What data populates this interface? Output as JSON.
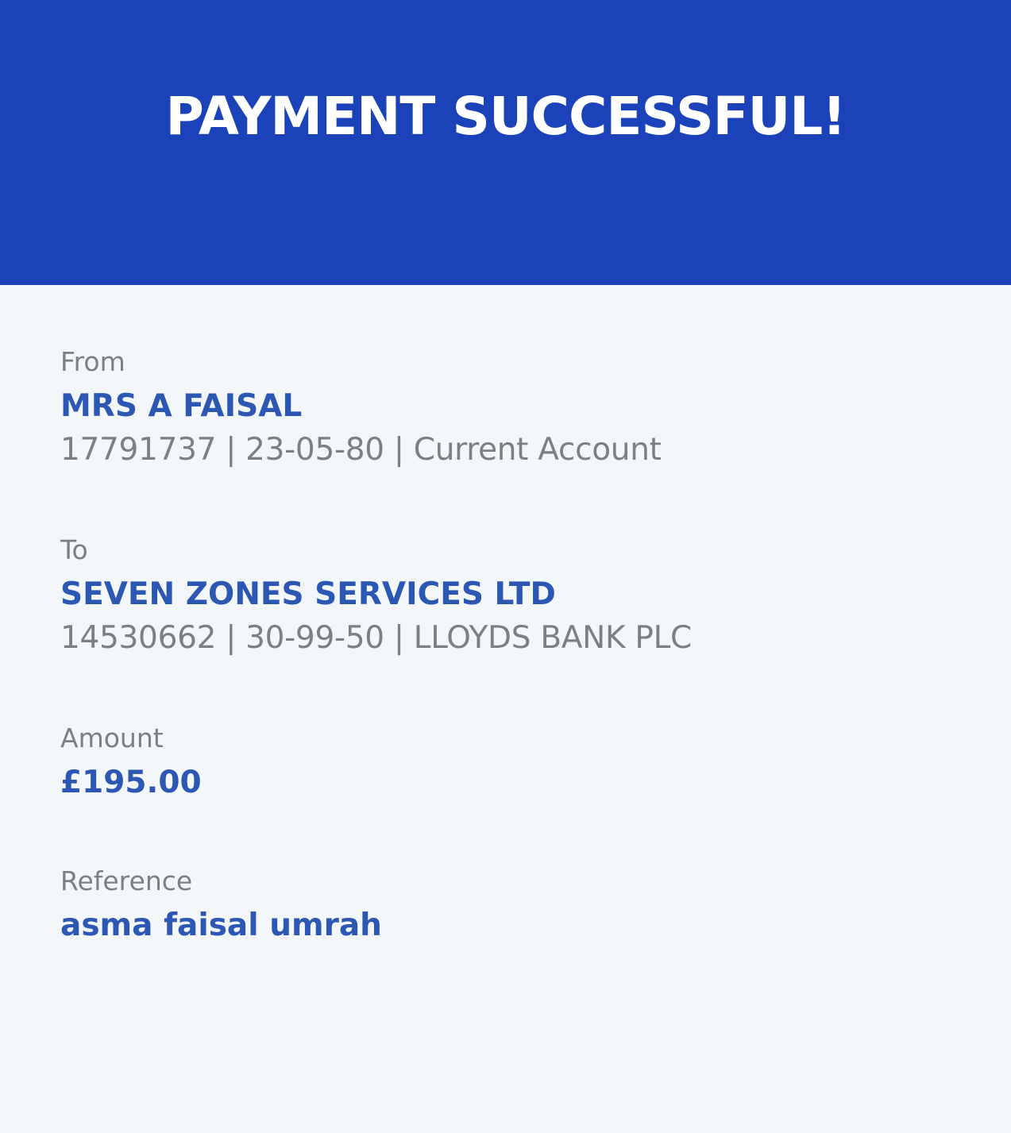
{
  "header": {
    "title": "PAYMENT SUCCESSFUL!",
    "background_color": "#1c42ba"
  },
  "from": {
    "label": "From",
    "name": "MRS A FAISAL",
    "account_details": "17791737 | 23-05-80 | Current Account"
  },
  "to": {
    "label": "To",
    "name": "SEVEN ZONES SERVICES LTD",
    "account_details": "14530662 | 30-99-50 | LLOYDS BANK PLC"
  },
  "amount": {
    "label": "Amount",
    "value": "£195.00"
  },
  "reference": {
    "label": "Reference",
    "value": "asma faisal umrah"
  },
  "colors": {
    "accent_text": "#2c57b3",
    "muted_text": "#7d7f85",
    "page_background": "#f3f7fa"
  }
}
